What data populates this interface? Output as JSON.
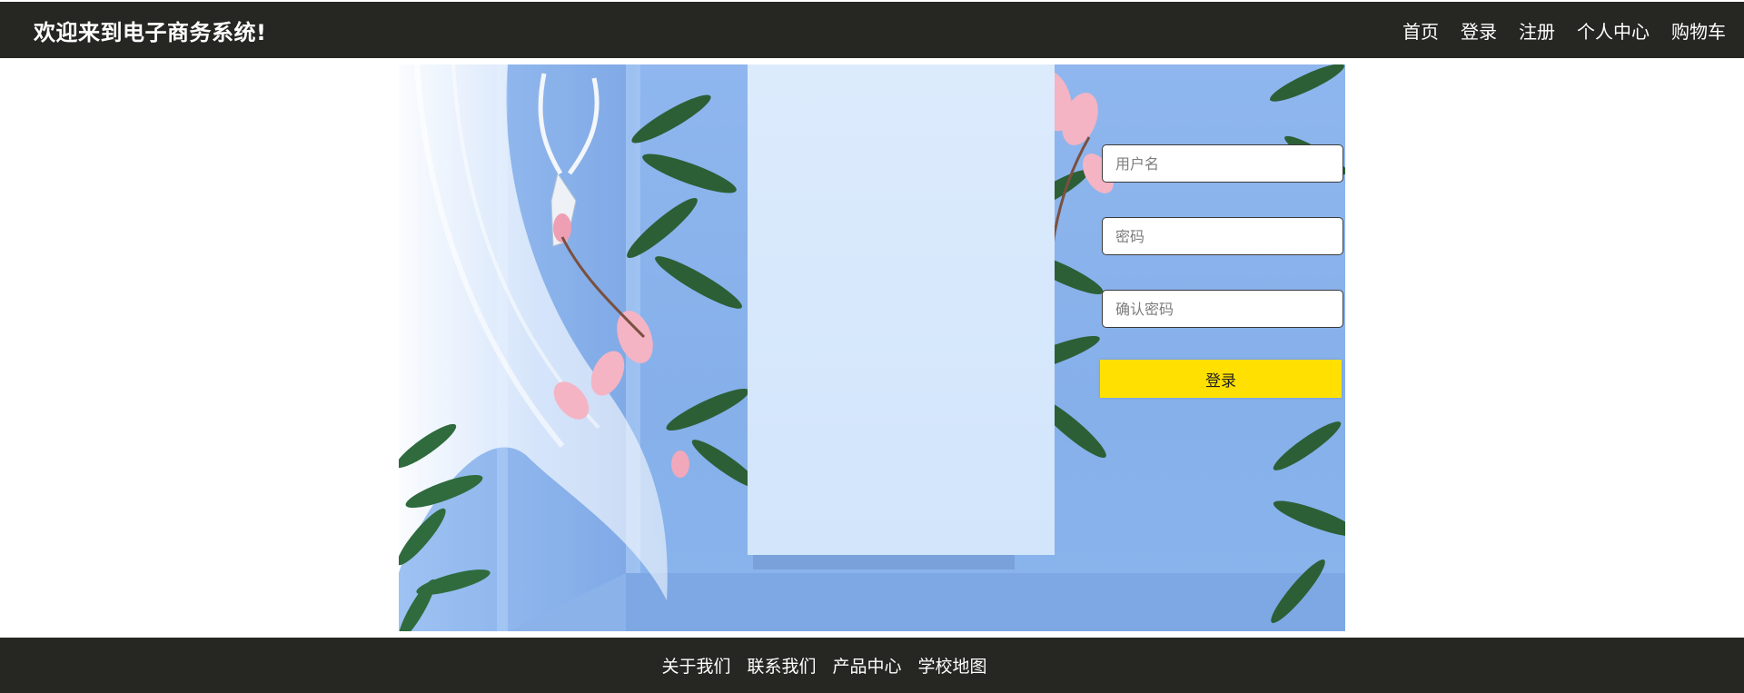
{
  "header": {
    "title": "欢迎来到电子商务系统!",
    "nav": [
      "首页",
      "登录",
      "注册",
      "个人中心",
      "购物车"
    ]
  },
  "login_form": {
    "username_placeholder": "用户名",
    "password_placeholder": "密码",
    "confirm_placeholder": "确认密码",
    "submit_label": "登录"
  },
  "footer": {
    "links": [
      "关于我们",
      "联系我们",
      "产品中心",
      "学校地图"
    ]
  },
  "colors": {
    "bar_background": "#262622",
    "button_yellow": "#ffe000",
    "banner_blue": "#8fb6ee"
  }
}
